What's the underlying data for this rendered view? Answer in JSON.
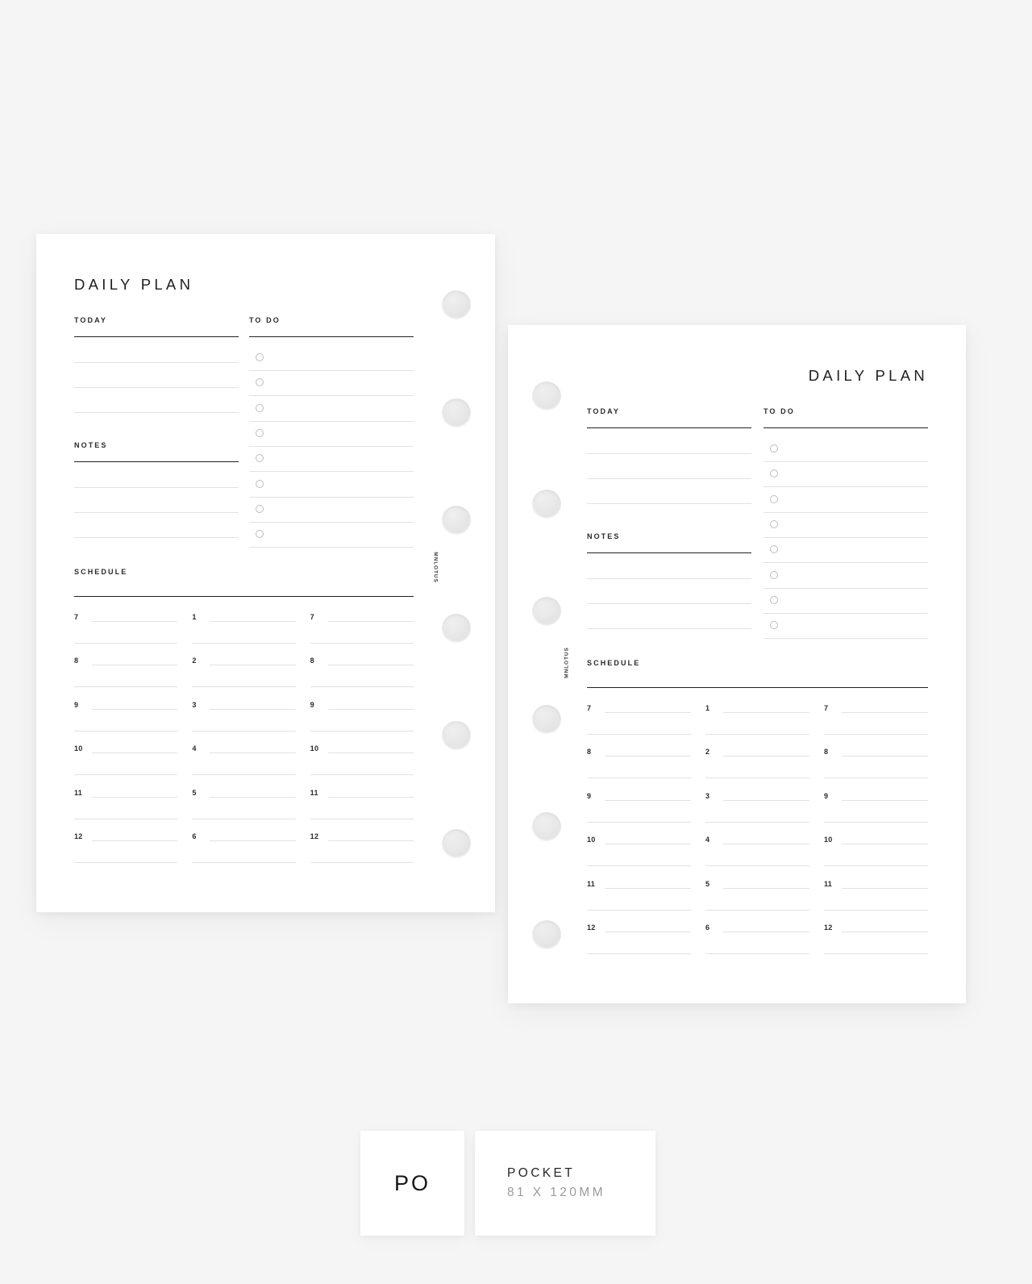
{
  "background_color": "#f5f5f5",
  "pages": [
    {
      "id": "left",
      "title": "DAILY PLAN",
      "title_align": "left",
      "holes_side": "right",
      "hole_count": 6,
      "brand": "MNLOTUS",
      "sections": {
        "today": {
          "label": "TODAY",
          "line_count": 3
        },
        "todo": {
          "label": "TO DO",
          "item_count": 8
        },
        "notes": {
          "label": "NOTES",
          "line_count": 3
        },
        "schedule": {
          "label": "SCHEDULE",
          "columns": [
            {
              "hours": [
                "7",
                "8",
                "9",
                "10",
                "11",
                "12"
              ]
            },
            {
              "hours": [
                "1",
                "2",
                "3",
                "4",
                "5",
                "6"
              ]
            },
            {
              "hours": [
                "7",
                "8",
                "9",
                "10",
                "11",
                "12"
              ]
            }
          ]
        }
      }
    },
    {
      "id": "right",
      "title": "DAILY PLAN",
      "title_align": "right",
      "holes_side": "left",
      "hole_count": 6,
      "brand": "MNLOTUS",
      "sections": {
        "today": {
          "label": "TODAY",
          "line_count": 3
        },
        "todo": {
          "label": "TO DO",
          "item_count": 8
        },
        "notes": {
          "label": "NOTES",
          "line_count": 3
        },
        "schedule": {
          "label": "SCHEDULE",
          "columns": [
            {
              "hours": [
                "7",
                "8",
                "9",
                "10",
                "11",
                "12"
              ]
            },
            {
              "hours": [
                "1",
                "2",
                "3",
                "4",
                "5",
                "6"
              ]
            },
            {
              "hours": [
                "7",
                "8",
                "9",
                "10",
                "11",
                "12"
              ]
            }
          ]
        }
      }
    }
  ],
  "badge": {
    "code": "PO",
    "size_name": "POCKET",
    "size_dimensions": "81 X 120MM"
  }
}
